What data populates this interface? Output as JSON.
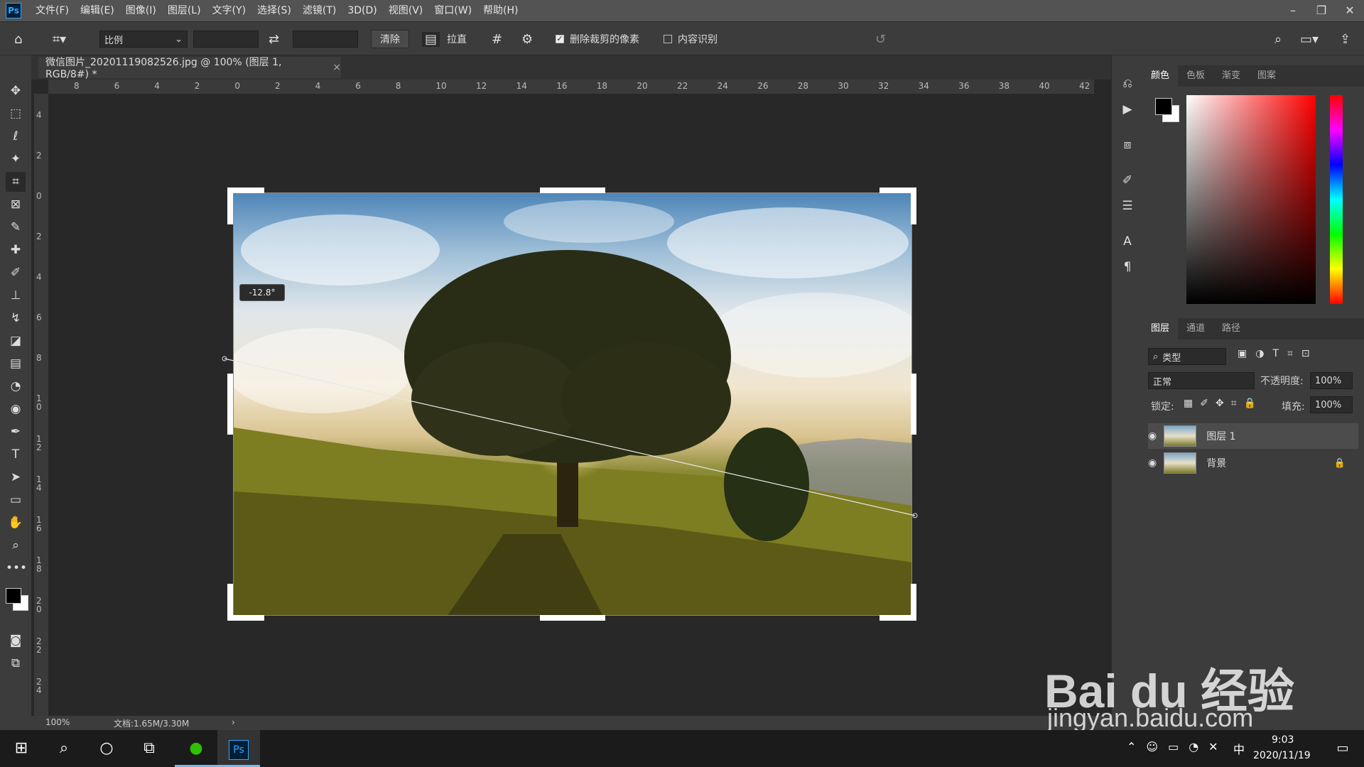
{
  "app": {
    "logo": "Ps"
  },
  "menu": [
    "文件(F)",
    "编辑(E)",
    "图像(I)",
    "图层(L)",
    "文字(Y)",
    "选择(S)",
    "滤镜(T)",
    "3D(D)",
    "视图(V)",
    "窗口(W)",
    "帮助(H)"
  ],
  "window_controls": {
    "minimize": "–",
    "restore": "❐",
    "close": "✕"
  },
  "options": {
    "ratio_value": "比例",
    "clear_label": "清除",
    "straighten_label": "拉直",
    "delete_cropped_label": "删除裁剪的像素",
    "delete_cropped_checked": true,
    "content_aware_label": "内容识别",
    "content_aware_checked": false
  },
  "document": {
    "tab_title": "微信图片_20201119082526.jpg @ 100% (图层 1, RGB/8#) *",
    "tab_close": "×",
    "zoom": "100%",
    "doc_info": "文档:1.65M/3.30M",
    "status_arrow": "›",
    "angle_readout": "-12.8°"
  },
  "rulers": {
    "horizontal": [
      "8",
      "6",
      "4",
      "2",
      "0",
      "2",
      "4",
      "6",
      "8",
      "10",
      "12",
      "14",
      "16",
      "18",
      "20",
      "22",
      "24",
      "26",
      "28",
      "30",
      "32",
      "34",
      "36",
      "38",
      "40",
      "42"
    ],
    "vertical": [
      "4",
      "2",
      "0",
      "2",
      "4",
      "6",
      "8",
      "10",
      "12",
      "14",
      "16",
      "18",
      "20",
      "22",
      "24"
    ]
  },
  "panels": {
    "color_tabs": [
      "颜色",
      "色板",
      "渐变",
      "图案"
    ],
    "layer_tabs": [
      "图层",
      "通道",
      "路径"
    ],
    "filter_kind": "类型",
    "blend_mode": "正常",
    "opacity_label": "不透明度:",
    "opacity_value": "100%",
    "lock_label": "锁定:",
    "fill_label": "填充:",
    "fill_value": "100%",
    "layers": [
      {
        "name": "图层 1",
        "selected": true,
        "locked": false
      },
      {
        "name": "背景",
        "selected": false,
        "locked": true
      }
    ]
  },
  "taskbar": {
    "time": "9:03",
    "date": "2020/11/19",
    "ime": "中",
    "ps_label": "Ps"
  },
  "watermark": {
    "brand": "Bai du 经验",
    "url": "jingyan.baidu.com"
  },
  "colors": {
    "accent": "#31a8ff",
    "foreground": "#000000",
    "background": "#ffffff"
  }
}
